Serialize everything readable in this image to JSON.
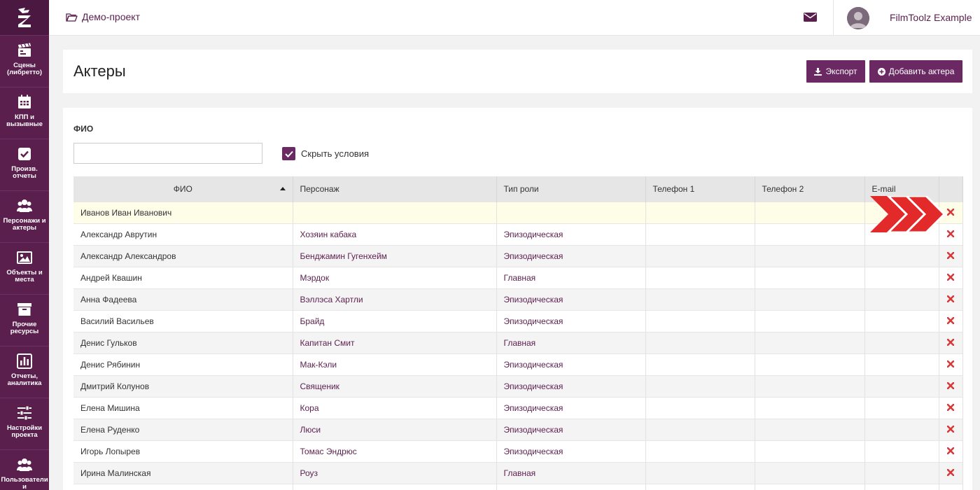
{
  "sidebar": {
    "items": [
      {
        "label": "Сцены\n(либретто)",
        "icon": "clapperboard-icon"
      },
      {
        "label": "КПП и\nвызывные",
        "icon": "calendar-icon"
      },
      {
        "label": "Произв.\nотчеты",
        "icon": "checkbox-icon"
      },
      {
        "label": "Персонажи и\nактеры",
        "icon": "users-icon"
      },
      {
        "label": "Объекты и\nместа",
        "icon": "image-icon"
      },
      {
        "label": "Прочие\nресурсы",
        "icon": "archive-icon"
      },
      {
        "label": "Отчеты,\nаналитика",
        "icon": "bar-chart-icon"
      },
      {
        "label": "Настройки\nпроекта",
        "icon": "sliders-icon"
      },
      {
        "label": "Пользователи и\nроли",
        "icon": "user-group-icon"
      }
    ]
  },
  "topbar": {
    "project": "Демо-проект",
    "username": "FilmToolz Example"
  },
  "page": {
    "title": "Актеры",
    "export_label": "Экспорт",
    "add_label": "Добавить актера"
  },
  "filter": {
    "label": "ФИО",
    "value": "",
    "hide_conditions_label": "Скрыть условия",
    "hide_conditions_checked": true
  },
  "table": {
    "columns": [
      "ФИО",
      "Персонаж",
      "Тип роли",
      "Телефон 1",
      "Телефон 2",
      "E-mail"
    ],
    "sort_column": "ФИО",
    "sort_dir": "asc",
    "rows": [
      {
        "name": "Иванов Иван Иванович",
        "character": "",
        "role": "",
        "phone1": "",
        "phone2": "",
        "email": ""
      },
      {
        "name": "Александр Аврутин",
        "character": "Хозяин кабака",
        "role": "Эпизодическая",
        "phone1": "",
        "phone2": "",
        "email": ""
      },
      {
        "name": "Александр Александров",
        "character": "Бенджамин Гугенхейм",
        "role": "Эпизодическая",
        "phone1": "",
        "phone2": "",
        "email": ""
      },
      {
        "name": "Андрей Квашин",
        "character": "Мэрдок",
        "role": "Главная",
        "phone1": "",
        "phone2": "",
        "email": ""
      },
      {
        "name": "Анна Фадеева",
        "character": "Вэллэса Хартли",
        "role": "Эпизодическая",
        "phone1": "",
        "phone2": "",
        "email": ""
      },
      {
        "name": "Василий Васильев",
        "character": "Брайд",
        "role": "Эпизодическая",
        "phone1": "",
        "phone2": "",
        "email": ""
      },
      {
        "name": "Денис Гульков",
        "character": "Капитан Смит",
        "role": "Главная",
        "phone1": "",
        "phone2": "",
        "email": ""
      },
      {
        "name": "Денис Рябинин",
        "character": "Мак-Кэли",
        "role": "Эпизодическая",
        "phone1": "",
        "phone2": "",
        "email": ""
      },
      {
        "name": "Дмитрий Колунов",
        "character": "Священик",
        "role": "Эпизодическая",
        "phone1": "",
        "phone2": "",
        "email": ""
      },
      {
        "name": "Елена Мишина",
        "character": "Кора",
        "role": "Эпизодическая",
        "phone1": "",
        "phone2": "",
        "email": ""
      },
      {
        "name": "Елена Руденко",
        "character": "Люси",
        "role": "Эпизодическая",
        "phone1": "",
        "phone2": "",
        "email": ""
      },
      {
        "name": "Игорь Лопырев",
        "character": "Томас Эндрюс",
        "role": "Эпизодическая",
        "phone1": "",
        "phone2": "",
        "email": ""
      },
      {
        "name": "Ирина Малинская",
        "character": "Роуз",
        "role": "Главная",
        "phone1": "",
        "phone2": "",
        "email": ""
      },
      {
        "name": "",
        "character": "",
        "role": "",
        "phone1": "",
        "phone2": "",
        "email": ""
      }
    ]
  },
  "colors": {
    "brand": "#5b1f4e",
    "button": "#6b2963",
    "delete": "#d9383a",
    "highlight_row": "#fdfde8",
    "arrow_annotation": "#e22a2a"
  }
}
